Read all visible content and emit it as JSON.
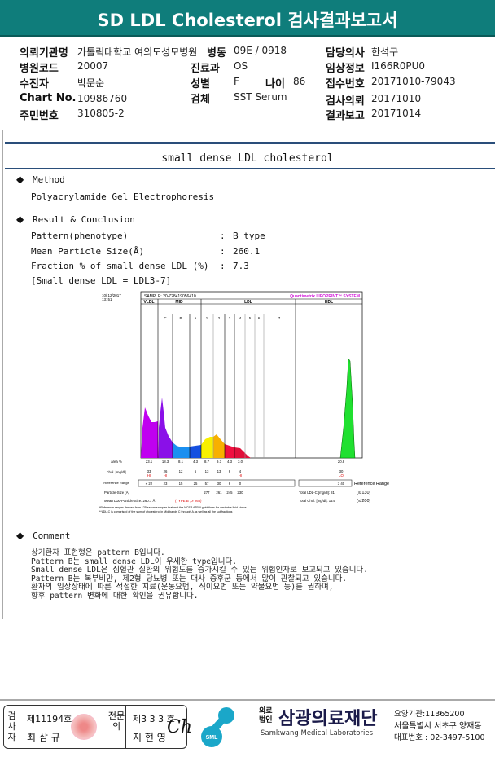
{
  "header": {
    "title": "SD LDL Cholesterol 검사결과보고서"
  },
  "info": {
    "inst_label": "의뢰기관명",
    "inst_value": "가톨릭대학교 여의도성모병원",
    "ward_label": "병동",
    "ward_value": "09E / 0918",
    "doctor_label": "담당의사",
    "doctor_value": "한석구",
    "code_label": "병원코드",
    "code_value": "20007",
    "dept_label": "진료과",
    "dept_value": "OS",
    "clinical_label": "임상정보",
    "clinical_value": "I166R0PU0",
    "patient_label": "수진자",
    "patient_value": "박문순",
    "sex_label": "성별",
    "sex_value": "F",
    "age_label": "나이",
    "age_value": "86",
    "receipt_label": "접수번호",
    "receipt_value": "20171010-79043",
    "chart_label": "Chart No.",
    "chart_value": "10986760",
    "specimen_label": "검체",
    "specimen_value": "SST Serum",
    "request_label": "검사의뢰",
    "request_value": "20171010",
    "id_label": "주민번호",
    "id_value": "310805-2",
    "report_label": "결과보고",
    "report_value": "20171014"
  },
  "section_title": "small dense LDL cholesterol",
  "method": {
    "heading": "Method",
    "text": "Polyacrylamide Gel Electrophoresis"
  },
  "result": {
    "heading": "Result & Conclusion",
    "rows": [
      {
        "label": "Pattern(phenotype)",
        "value": "B type"
      },
      {
        "label": "Mean Particle Size(Å)",
        "value": "260.1"
      },
      {
        "label": "Fraction % of small dense LDL (%)",
        "value": "7.3"
      }
    ],
    "note": "[Small dense LDL = LDL3-7]"
  },
  "chart_data": {
    "type": "area",
    "date": "10/ 12/2017",
    "time": "13: 51",
    "sample": "SAMPLE:   20-728419056410",
    "system": "Quantimetrix LIPOPRINT™ SYSTEM",
    "groups": [
      "VLDL",
      "MID",
      "LDL",
      "HDL"
    ],
    "bands": [
      "C",
      "B",
      "A",
      "1",
      "2",
      "3",
      "4",
      "5",
      "6",
      "7"
    ],
    "row_labels": {
      "area": "area %",
      "chol": "chol. [mg/dl]",
      "ref": "Reference Range",
      "ref_right": "Reference Range",
      "size": "Particle-Size (Å)",
      "mean": "Mean LDL-Particle Size:   260.1 Å",
      "type": "(TYPE B ; ≥ 265)"
    },
    "area": [
      "23.1",
      "18.3",
      "8.1",
      "4.3",
      "8.7",
      "9.3",
      "4.3",
      "3.0",
      "20.8"
    ],
    "chol": [
      "33",
      "26",
      "12",
      "6",
      "13",
      "13",
      "6",
      "4",
      "30"
    ],
    "flags": [
      "HI",
      "HI",
      "",
      "",
      "",
      "",
      "",
      "HI",
      "LO"
    ],
    "ref": [
      "≤ 22",
      "23",
      "15",
      "25",
      "57",
      "30",
      "6",
      "0",
      "≥ 40"
    ],
    "size": [
      "277",
      "261",
      "245",
      "230"
    ],
    "total_ldl": "Total LDL-C [mg/dl]:  81",
    "total_ldl_ref": "(≤ 130)",
    "total_chol": "Total Chol. [mg/dl]:   144",
    "total_chol_ref": "(≤ 200)",
    "footnote1": "*Reference ranges derived from 125 serum samples that met the NCEP ATPIII guidelines for desirable lipid status",
    "footnote2": "**LDL-C is comprised of the sum of cholesterol in Mid bands C through A as well as all the subfractions"
  },
  "comment": {
    "heading": "Comment",
    "lines": [
      "상기환자 표현형은 pattern B입니다.",
      "Pattern B는 small dense LDL이 우세한 type입니다.",
      "Small dense LDL은 심혈관 질환의 위험도를 증가시킬 수 있는 위험인자로 보고되고 있습니다.",
      "Pattern B는 복부비만, 제2형 당뇨병 또는 대사 증후군 등에서 많이 관찰되고 있습니다.",
      "환자의 임상상태에 따른 적절한 치료(운동요법, 식이요법 또는 약물요법 등)를 권하며,",
      "향후 pattern 변화에 대한 확인을 권유합니다."
    ]
  },
  "footer": {
    "tech_label": "검사자",
    "tech_no": "제11194호",
    "tech_name": "최 삼 규",
    "doc_label": "전문의",
    "doc_no": "제3 3 3 호",
    "doc_name": "지 현 영",
    "org_type": "의료법인",
    "org_name": "삼광의료재단",
    "org_en": "Samkwang Medical Laboratories",
    "logo": "SML",
    "code": "요양기관:11365200",
    "address": "서울특별시 서초구 양재동",
    "phone": "대표번호 : 02-3497-5100"
  }
}
